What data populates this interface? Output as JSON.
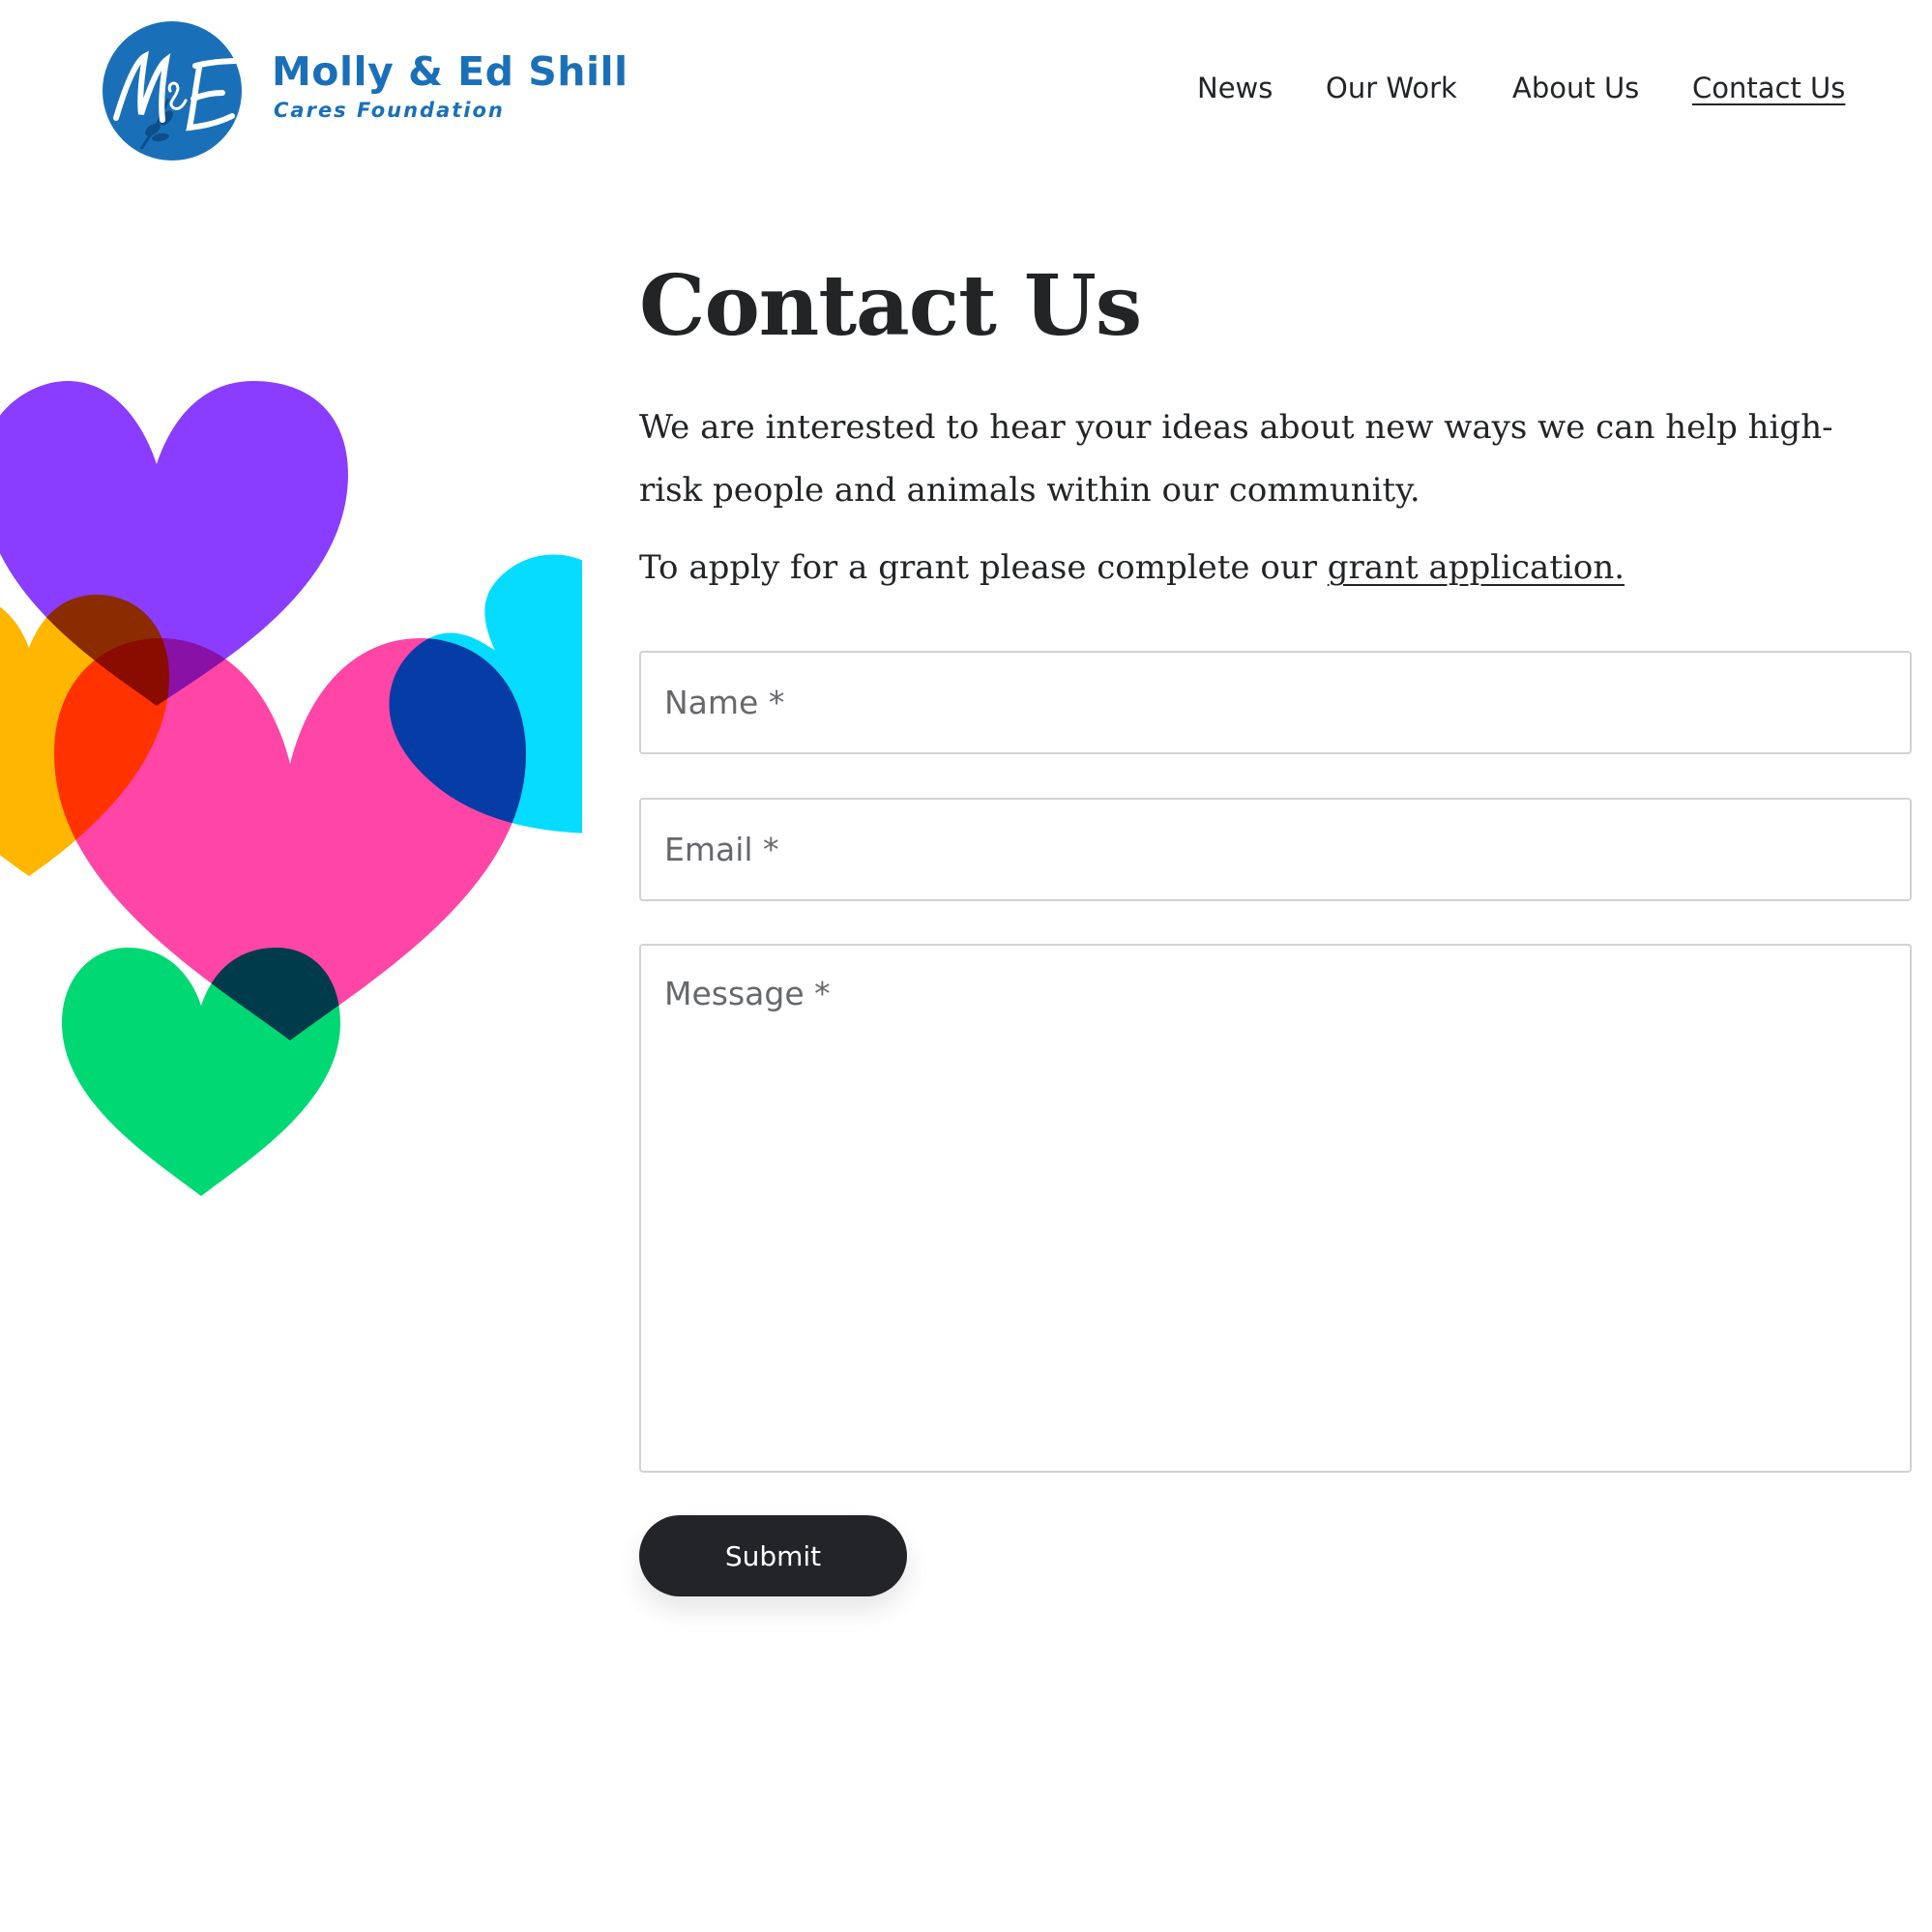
{
  "header": {
    "logo": {
      "monogram": "M&E",
      "name": "Molly & Ed Shill",
      "subtitle": "Cares Foundation"
    },
    "nav": {
      "items": [
        {
          "label": "News",
          "active": false
        },
        {
          "label": "Our Work",
          "active": false
        },
        {
          "label": "About Us",
          "active": false
        },
        {
          "label": "Contact Us",
          "active": true
        }
      ]
    }
  },
  "main": {
    "title": "Contact Us",
    "intro": "We are interested to hear your ideas about new ways we can help high-risk people and animals within our community.",
    "grant": {
      "prefix": "To apply for a grant please complete our ",
      "link_label": "grant application."
    },
    "form": {
      "name_placeholder": "Name *",
      "email_placeholder": "Email *",
      "message_placeholder": "Message *",
      "submit_label": "Submit"
    }
  },
  "illustration": {
    "name": "overlapping-hearts",
    "colors": {
      "purple": "#8a3cff",
      "cyan": "#05dcff",
      "pink": "#ff45a6",
      "orange": "#ffb600",
      "green": "#00d874"
    }
  },
  "colors": {
    "brand_blue": "#1a70b8",
    "text": "#222426",
    "button_bg": "#232427",
    "field_border": "#d2d2d4"
  }
}
